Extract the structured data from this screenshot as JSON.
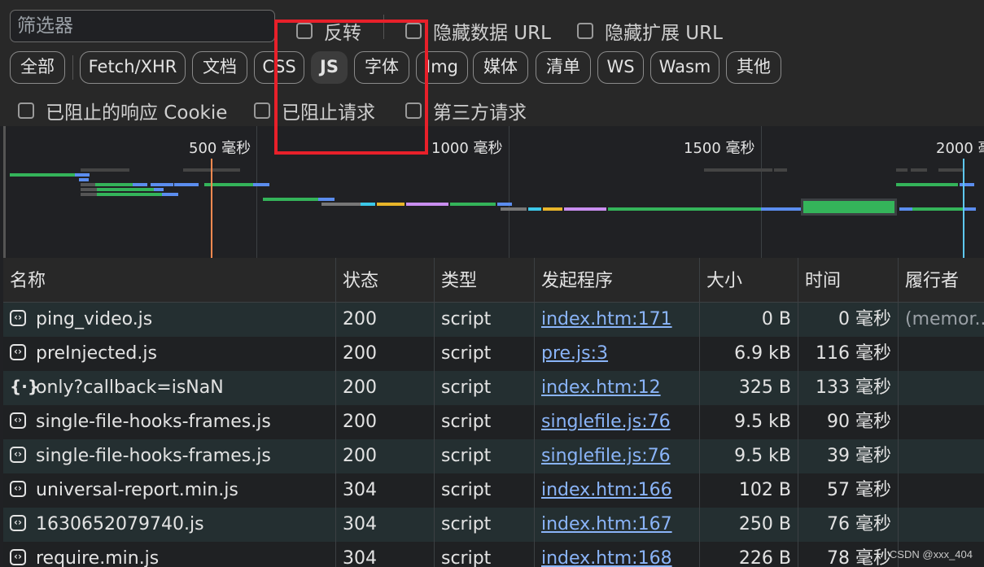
{
  "filter": {
    "placeholder": "筛选器"
  },
  "checkboxes": {
    "invert": "反转",
    "hide_data_url": "隐藏数据 URL",
    "hide_ext_url": "隐藏扩展 URL",
    "blocked_cookies": "已阻止的响应 Cookie",
    "blocked_requests": "已阻止请求",
    "third_party": "第三方请求"
  },
  "type_filters": [
    "全部",
    "Fetch/XHR",
    "文档",
    "CSS",
    "JS",
    "字体",
    "Img",
    "媒体",
    "清单",
    "WS",
    "Wasm",
    "其他"
  ],
  "active_filter": "JS",
  "overview": {
    "ticks": [
      "500  毫秒",
      "1000  毫秒",
      "1500  毫秒",
      "2000  毫秒"
    ]
  },
  "columns": [
    "名称",
    "状态",
    "类型",
    "发起程序",
    "大小",
    "时间",
    "履行者"
  ],
  "rows": [
    {
      "icon": "script-icon",
      "name": "ping_video.js",
      "status": "200",
      "type": "script",
      "initiator": "index.htm:171",
      "size": "0 B",
      "time": "0  毫秒",
      "fulfilled": "(memor..."
    },
    {
      "icon": "script-icon",
      "name": "preInjected.js",
      "status": "200",
      "type": "script",
      "initiator": "pre.js:3",
      "size": "6.9 kB",
      "time": "116  毫秒",
      "fulfilled": ""
    },
    {
      "icon": "json-icon",
      "name": "only?callback=isNaN",
      "status": "200",
      "type": "script",
      "initiator": "index.htm:12",
      "size": "325 B",
      "time": "133  毫秒",
      "fulfilled": ""
    },
    {
      "icon": "script-icon",
      "name": "single-file-hooks-frames.js",
      "status": "200",
      "type": "script",
      "initiator": "singlefile.js:76",
      "size": "9.5 kB",
      "time": "90  毫秒",
      "fulfilled": ""
    },
    {
      "icon": "script-icon",
      "name": "single-file-hooks-frames.js",
      "status": "200",
      "type": "script",
      "initiator": "singlefile.js:76",
      "size": "9.5 kB",
      "time": "39  毫秒",
      "fulfilled": ""
    },
    {
      "icon": "script-icon",
      "name": "universal-report.min.js",
      "status": "304",
      "type": "script",
      "initiator": "index.htm:166",
      "size": "102 B",
      "time": "57  毫秒",
      "fulfilled": ""
    },
    {
      "icon": "script-icon",
      "name": "1630652079740.js",
      "status": "304",
      "type": "script",
      "initiator": "index.htm:167",
      "size": "250 B",
      "time": "76  毫秒",
      "fulfilled": ""
    },
    {
      "icon": "script-icon",
      "name": "require.min.js",
      "status": "304",
      "type": "script",
      "initiator": "index.htm:168",
      "size": "226 B",
      "time": "78  毫秒",
      "fulfilled": ""
    }
  ],
  "watermark": "CSDN @xxx_404"
}
